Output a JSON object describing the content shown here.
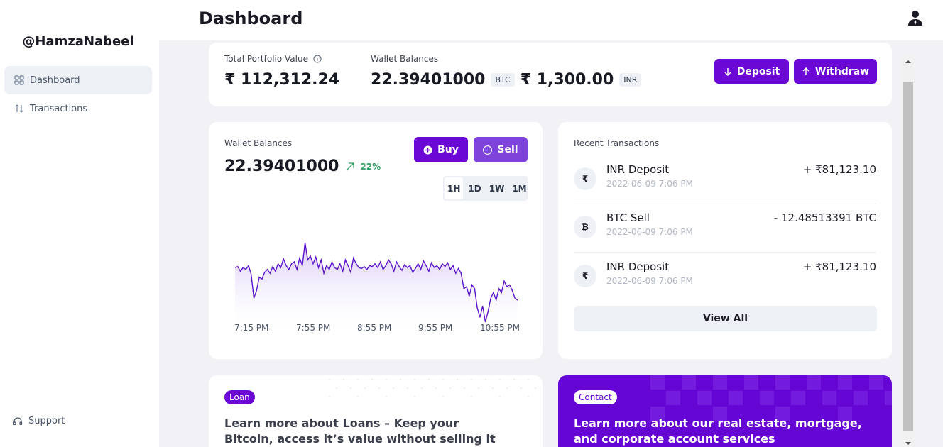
{
  "sidebar": {
    "brand": "@HamzaNabeel",
    "items": [
      {
        "label": "Dashboard",
        "icon": "grid-icon"
      },
      {
        "label": "Transactions",
        "icon": "arrows-up-down-icon"
      }
    ],
    "support_label": "Support"
  },
  "header": {
    "title": "Dashboard",
    "user_icon": "user-icon"
  },
  "portfolio": {
    "total_label": "Total Portfolio Value",
    "total_value": "₹ 112,312.24",
    "wallet_label": "Wallet Balances",
    "btc_value": "22.39401000",
    "btc_tag": "BTC",
    "inr_value": "₹ 1,300.00",
    "inr_tag": "INR",
    "deposit_label": "Deposit",
    "withdraw_label": "Withdraw"
  },
  "wallet": {
    "label": "Wallet Balances",
    "value": "22.39401000",
    "change": "22%",
    "buy_label": "Buy",
    "sell_label": "Sell",
    "ranges": [
      "1H",
      "1D",
      "1W",
      "1M"
    ],
    "active_range": "1H"
  },
  "chart_data": {
    "type": "area",
    "x_ticks": [
      "7:15 PM",
      "7:55 PM",
      "8:55 PM",
      "9:55 PM",
      "10:55 PM"
    ],
    "values": [
      62,
      63,
      58,
      62,
      60,
      64,
      55,
      30,
      38,
      52,
      50,
      57,
      60,
      56,
      63,
      58,
      66,
      62,
      71,
      64,
      60,
      66,
      68,
      60,
      72,
      64,
      88,
      70,
      74,
      66,
      73,
      62,
      70,
      56,
      64,
      60,
      68,
      62,
      60,
      66,
      58,
      70,
      64,
      57,
      72,
      66,
      62,
      61,
      63,
      60,
      64,
      63,
      66,
      62,
      68,
      60,
      64,
      70,
      66,
      58,
      68,
      63,
      59,
      65,
      62,
      64,
      57,
      61,
      66,
      60,
      69,
      64,
      58,
      67,
      62,
      64,
      60,
      66,
      63,
      67,
      60,
      64,
      56,
      61,
      56,
      40,
      42,
      32,
      44,
      40,
      20,
      10,
      22,
      5,
      16,
      30,
      36,
      28,
      40,
      36,
      48,
      42,
      44,
      38,
      30,
      28
    ],
    "color": "#5b14c9"
  },
  "recent": {
    "title": "Recent Transactions",
    "items": [
      {
        "icon_char": "₹",
        "icon": "rupee-icon",
        "title": "INR Deposit",
        "date": "2022-06-09 7:06 PM",
        "amount": "+ ₹81,123.10"
      },
      {
        "icon_char": "₿",
        "icon": "bitcoin-icon",
        "title": "BTC Sell",
        "date": "2022-06-09 7:06 PM",
        "amount": "- 12.48513391 BTC"
      },
      {
        "icon_char": "₹",
        "icon": "rupee-icon",
        "title": "INR Deposit",
        "date": "2022-06-09 7:06 PM",
        "amount": "+ ₹81,123.10"
      }
    ],
    "view_all_label": "View All"
  },
  "loan_card": {
    "tag": "Loan",
    "text": "Learn more about Loans – Keep your Bitcoin, access it’s value without selling it"
  },
  "contact_card": {
    "tag": "Contact",
    "text": "Learn more about our real estate, mortgage, and corporate account services"
  },
  "colors": {
    "accent": "#6b08d6",
    "positive": "#38a169",
    "muted": "#b0b6c3"
  }
}
